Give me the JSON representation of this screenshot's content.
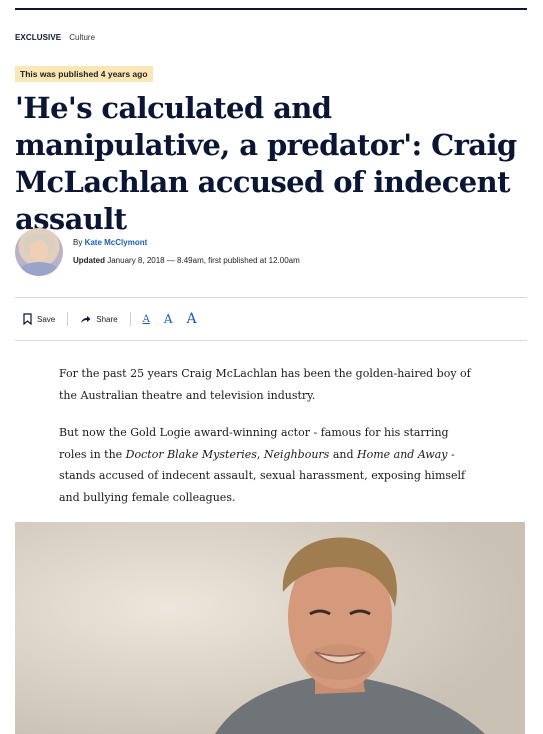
{
  "kicker": {
    "exclusive": "EXCLUSIVE",
    "section": "Culture"
  },
  "published_notice": "This was published 4 years ago",
  "headline": "'He's calculated and manipulative, a predator': Craig McLachlan accused of indecent assault",
  "byline": {
    "prefix": "By",
    "author": "Kate McClymont"
  },
  "updated": {
    "label": "Updated",
    "text": "January 8, 2018 — 8.49am, first published at 12.00am"
  },
  "toolbar": {
    "save_label": "Save",
    "share_label": "Share",
    "font_sizes": [
      "A",
      "A",
      "A"
    ]
  },
  "paragraphs": [
    {
      "text": "For the past 25 years Craig McLachlan has been the golden-haired boy of the Australian theatre and television industry."
    },
    {
      "p1": "But now the Gold Logie award-winning actor - famous for his starring roles in the ",
      "i1": "Doctor Blake Mysteries",
      "p2": ", ",
      "i2": "Neighbours",
      "p3": " and ",
      "i3": "Home and Away",
      "p4": " - stands accused of indecent assault, sexual harassment, exposing himself and bullying female colleagues."
    }
  ],
  "colors": {
    "accent": "#1a5fb4",
    "headline": "#0a1633",
    "notice_bg": "#fbe7b5"
  },
  "icons": {
    "save": "bookmark-icon",
    "share": "share-arrow-icon"
  }
}
